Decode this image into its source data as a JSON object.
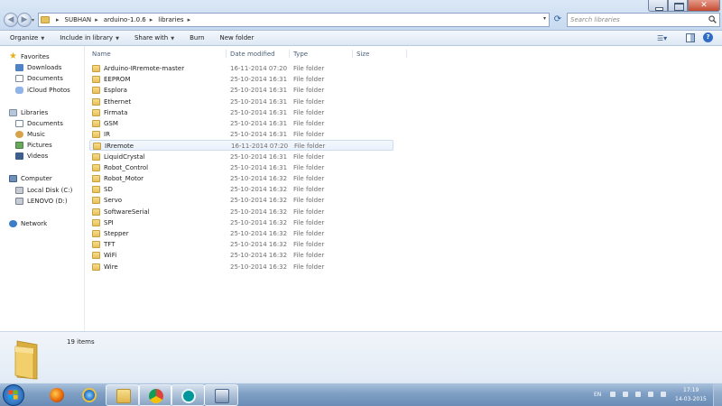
{
  "address_bar": {
    "breadcrumbs": [
      "SUBHAN",
      "arduino-1.0.6",
      "libraries"
    ],
    "search_placeholder": "Search libraries"
  },
  "toolbar": {
    "organize": "Organize",
    "include_in_library": "Include in library",
    "share_with": "Share with",
    "burn": "Burn",
    "new_folder": "New folder"
  },
  "nav_pane": {
    "favorites_header": "Favorites",
    "favorites": [
      "Downloads",
      "Documents",
      "iCloud Photos"
    ],
    "libraries_header": "Libraries",
    "libraries": [
      "Documents",
      "Music",
      "Pictures",
      "Videos"
    ],
    "computer_header": "Computer",
    "drives": [
      "Local Disk (C:)",
      "LENOVO (D:)"
    ],
    "network_header": "Network"
  },
  "columns": {
    "name": "Name",
    "date_modified": "Date modified",
    "type": "Type",
    "size": "Size"
  },
  "files": [
    {
      "name": "Arduino-IRremote-master",
      "date": "16-11-2014 07:20",
      "type": "File folder"
    },
    {
      "name": "EEPROM",
      "date": "25-10-2014 16:31",
      "type": "File folder"
    },
    {
      "name": "Esplora",
      "date": "25-10-2014 16:31",
      "type": "File folder"
    },
    {
      "name": "Ethernet",
      "date": "25-10-2014 16:31",
      "type": "File folder"
    },
    {
      "name": "Firmata",
      "date": "25-10-2014 16:31",
      "type": "File folder"
    },
    {
      "name": "GSM",
      "date": "25-10-2014 16:31",
      "type": "File folder"
    },
    {
      "name": "IR",
      "date": "25-10-2014 16:31",
      "type": "File folder"
    },
    {
      "name": "IRremote",
      "date": "16-11-2014 07:20",
      "type": "File folder",
      "selected": true
    },
    {
      "name": "LiquidCrystal",
      "date": "25-10-2014 16:31",
      "type": "File folder"
    },
    {
      "name": "Robot_Control",
      "date": "25-10-2014 16:31",
      "type": "File folder"
    },
    {
      "name": "Robot_Motor",
      "date": "25-10-2014 16:32",
      "type": "File folder"
    },
    {
      "name": "SD",
      "date": "25-10-2014 16:32",
      "type": "File folder"
    },
    {
      "name": "Servo",
      "date": "25-10-2014 16:32",
      "type": "File folder"
    },
    {
      "name": "SoftwareSerial",
      "date": "25-10-2014 16:32",
      "type": "File folder"
    },
    {
      "name": "SPI",
      "date": "25-10-2014 16:32",
      "type": "File folder"
    },
    {
      "name": "Stepper",
      "date": "25-10-2014 16:32",
      "type": "File folder"
    },
    {
      "name": "TFT",
      "date": "25-10-2014 16:32",
      "type": "File folder"
    },
    {
      "name": "WiFi",
      "date": "25-10-2014 16:32",
      "type": "File folder"
    },
    {
      "name": "Wire",
      "date": "25-10-2014 16:32",
      "type": "File folder"
    }
  ],
  "details": {
    "item_count": "19 items"
  },
  "taskbar": {
    "apps": [
      "firefox-icon",
      "internet-explorer-icon",
      "windows-explorer-icon",
      "chrome-icon",
      "arduino-icon",
      "network-printer-icon"
    ],
    "tray_language": "EN",
    "clock_time": "17:19",
    "clock_date": "14-03-2015"
  },
  "colors": {
    "accent": "#2f6cc5",
    "folder": "#e7c15b",
    "taskbar": "#7f9fc4",
    "selection": "#e9f1fb"
  }
}
